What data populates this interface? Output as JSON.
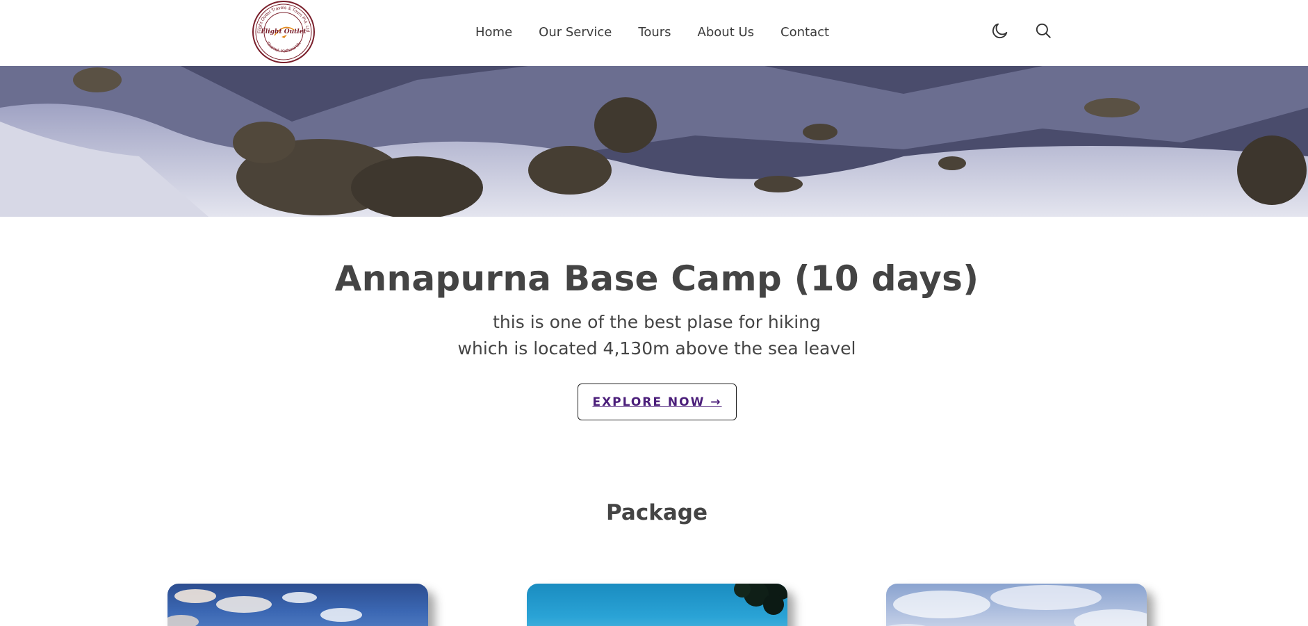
{
  "header": {
    "logo": {
      "ring_text_top": "Flight Outlet Travels & Tours Pvt. Ltd.",
      "center_text": "Flight Outlet",
      "ring_text_bottom": "Thamel, Kathmandu"
    },
    "nav": [
      {
        "label": "Home"
      },
      {
        "label": "Our Service"
      },
      {
        "label": "Tours"
      },
      {
        "label": "About Us"
      },
      {
        "label": "Contact"
      }
    ],
    "icons": [
      "moon-icon",
      "search-icon"
    ]
  },
  "hero": {
    "title": "Annapurna Base Camp (10 days)",
    "subtitle_line1": "this is one of the best plase for hiking",
    "subtitle_line2": "which is located 4,130m above the sea leavel",
    "cta_label": "EXPLORE NOW →"
  },
  "packages": {
    "title": "Package"
  },
  "colors": {
    "cta_text": "#4b1e7a",
    "logo_maroon": "#7a1f2b",
    "text": "#444444"
  }
}
